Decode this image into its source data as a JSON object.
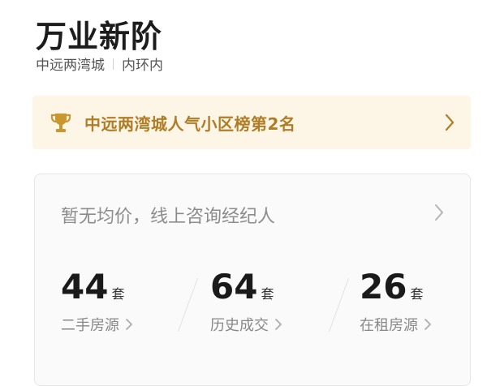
{
  "header": {
    "title": "万业新阶",
    "district": "中远两湾城",
    "ring": "内环内"
  },
  "rank_banner": {
    "text": "中远两湾城人气小区榜第2名",
    "icon": "trophy-icon",
    "color": "#b07d26",
    "background": "#fdf6e6"
  },
  "price_card": {
    "avg_text": "暂无均价，线上咨询经纪人",
    "stats": [
      {
        "value": "44",
        "unit": "套",
        "label": "二手房源"
      },
      {
        "value": "64",
        "unit": "套",
        "label": "历史成交"
      },
      {
        "value": "26",
        "unit": "套",
        "label": "在租房源"
      }
    ]
  }
}
